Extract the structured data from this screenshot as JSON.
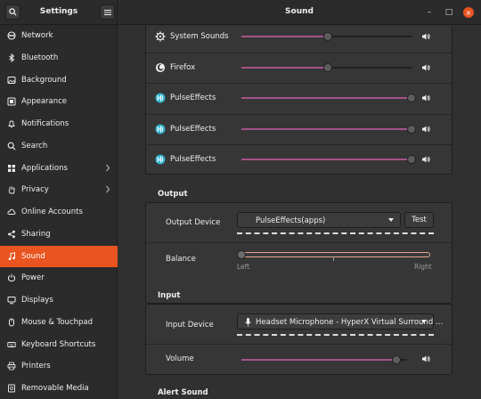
{
  "window": {
    "sidebar_title": "Settings",
    "main_title": "Sound",
    "controls": {
      "minimize": "–",
      "maximize": "□",
      "close": "×"
    }
  },
  "sidebar": {
    "items": [
      {
        "label": "Network",
        "icon": "network-icon"
      },
      {
        "label": "Bluetooth",
        "icon": "bluetooth-icon"
      },
      {
        "label": "Background",
        "icon": "background-icon"
      },
      {
        "label": "Appearance",
        "icon": "appearance-icon"
      },
      {
        "label": "Notifications",
        "icon": "bell-icon"
      },
      {
        "label": "Search",
        "icon": "search-icon"
      },
      {
        "label": "Applications",
        "icon": "applications-icon",
        "chevron": true
      },
      {
        "label": "Privacy",
        "icon": "hand-icon",
        "chevron": true
      },
      {
        "label": "Online Accounts",
        "icon": "cloud-icon"
      },
      {
        "label": "Sharing",
        "icon": "share-icon"
      },
      {
        "label": "Sound",
        "icon": "music-note-icon",
        "active": true
      },
      {
        "label": "Power",
        "icon": "power-icon"
      },
      {
        "label": "Displays",
        "icon": "display-icon"
      },
      {
        "label": "Mouse & Touchpad",
        "icon": "mouse-icon"
      },
      {
        "label": "Keyboard Shortcuts",
        "icon": "keyboard-icon"
      },
      {
        "label": "Printers",
        "icon": "printer-icon"
      },
      {
        "label": "Removable Media",
        "icon": "media-icon"
      }
    ]
  },
  "apps": [
    {
      "name": "System Sounds",
      "icon": "system-sounds-icon",
      "level": 0.51
    },
    {
      "name": "Firefox",
      "icon": "firefox-icon",
      "level": 0.51
    },
    {
      "name": "PulseEffects",
      "icon": "pulseeffects-icon",
      "level": 1.0
    },
    {
      "name": "PulseEffects",
      "icon": "pulseeffects-icon",
      "level": 1.0
    },
    {
      "name": "PulseEffects",
      "icon": "pulseeffects-icon",
      "level": 1.0
    }
  ],
  "output": {
    "title": "Output",
    "device_label": "Output Device",
    "device_value": "PulseEffects(apps)",
    "test_label": "Test",
    "balance_label": "Balance",
    "balance_left": "Left",
    "balance_right": "Right",
    "balance_level": 0.0
  },
  "input": {
    "title": "Input",
    "device_label": "Input Device",
    "device_value": "Headset Microphone - HyperX Virtual Surround …",
    "volume_label": "Volume",
    "volume_level": 0.94
  },
  "alert": {
    "title": "Alert Sound"
  },
  "colors": {
    "accent": "#e95420",
    "slider_fill": "#a4528a"
  }
}
